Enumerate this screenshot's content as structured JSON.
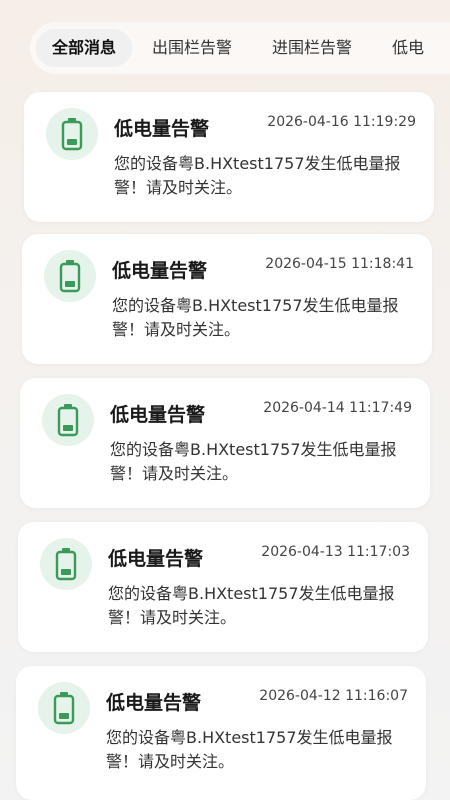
{
  "tabs": [
    {
      "label": "全部消息",
      "active": true
    },
    {
      "label": "出围栏告警",
      "active": false
    },
    {
      "label": "进围栏告警",
      "active": false
    },
    {
      "label": "低电",
      "active": false
    }
  ],
  "cards": [
    {
      "title": "低电量告警",
      "time": "2026-04-16 11:19:29",
      "body": "您的设备粤B.HXtest1757发生低电量报警！请及时关注。"
    },
    {
      "title": "低电量告警",
      "time": "2026-04-15 11:18:41",
      "body": "您的设备粤B.HXtest1757发生低电量报警！请及时关注。"
    },
    {
      "title": "低电量告警",
      "time": "2026-04-14 11:17:49",
      "body": "您的设备粤B.HXtest1757发生低电量报警！请及时关注。"
    },
    {
      "title": "低电量告警",
      "time": "2026-04-13 11:17:03",
      "body": "您的设备粤B.HXtest1757发生低电量报警！请及时关注。"
    },
    {
      "title": "低电量告警",
      "time": "2026-04-12 11:16:07",
      "body": "您的设备粤B.HXtest1757发生低电量报警！请及时关注。"
    }
  ],
  "colors": {
    "accent_green": "#3a9a5a",
    "icon_bg": "#e6f3ea"
  },
  "icons": {
    "card_icon": "battery-low-icon"
  }
}
